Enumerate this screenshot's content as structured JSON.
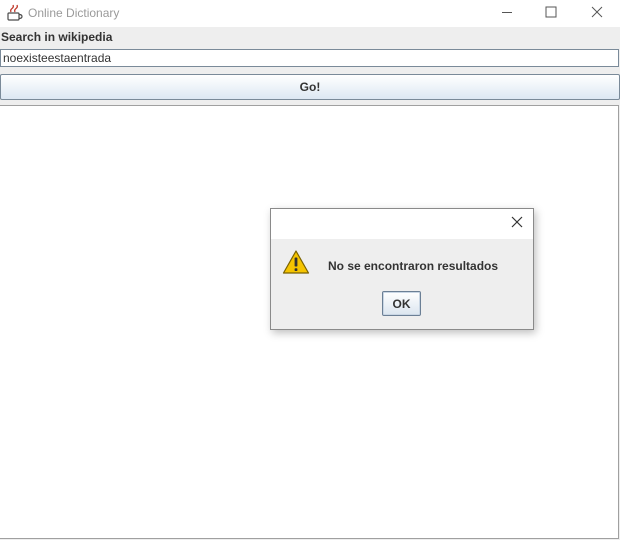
{
  "window": {
    "title": "Online Dictionary",
    "icons": {
      "app": "java-cup-icon",
      "minimize": "minimize-icon",
      "maximize": "maximize-icon",
      "close": "close-icon"
    }
  },
  "search": {
    "label": "Search in wikipedia",
    "value": "noexisteestaentrada",
    "button_label": "Go!"
  },
  "dialog": {
    "icon": "warning-icon",
    "message": "No se encontraron resultados",
    "ok_label": "OK",
    "accent": "#f5c400"
  }
}
